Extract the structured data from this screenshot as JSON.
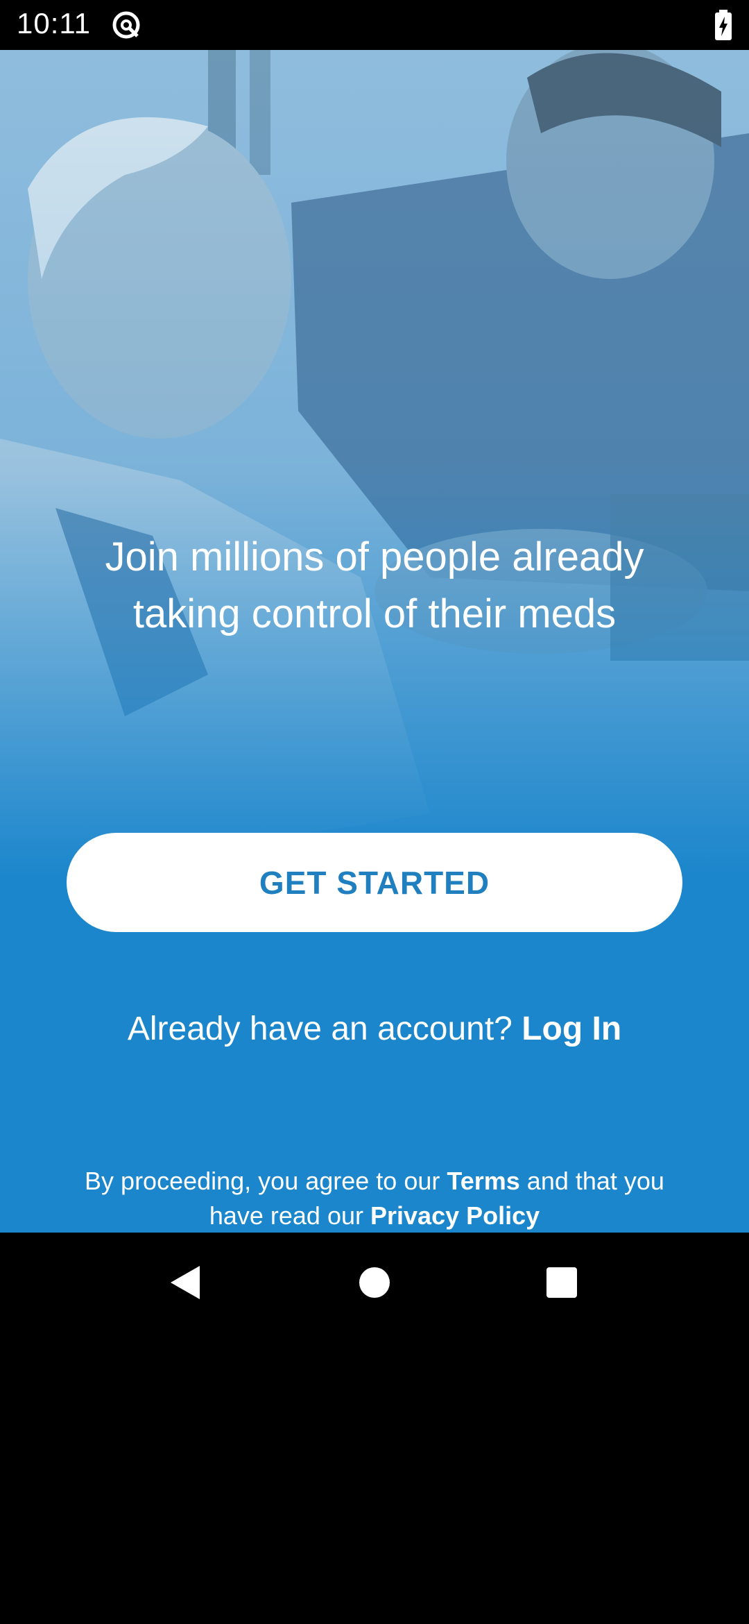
{
  "status_bar": {
    "time": "10:11",
    "app_icon": "at-sign-circle-icon",
    "battery_icon": "battery-charging-icon"
  },
  "hero": {
    "image": "two-men-smiling-photo",
    "headline": "Join millions of people already taking control of their meds"
  },
  "cta": {
    "label": "GET STARTED"
  },
  "login": {
    "prompt": "Already have an account?",
    "link": "Log In"
  },
  "legal": {
    "prefix": "By proceeding, you agree to our",
    "terms_link": "Terms",
    "middle": "and that you have read our",
    "privacy_link": "Privacy Policy"
  },
  "nav": {
    "back_icon": "back-triangle-icon",
    "home_icon": "home-circle-icon",
    "recent_icon": "recent-square-icon"
  },
  "colors": {
    "brand_blue": "#1b86cc",
    "button_text": "#1f7fbf"
  }
}
